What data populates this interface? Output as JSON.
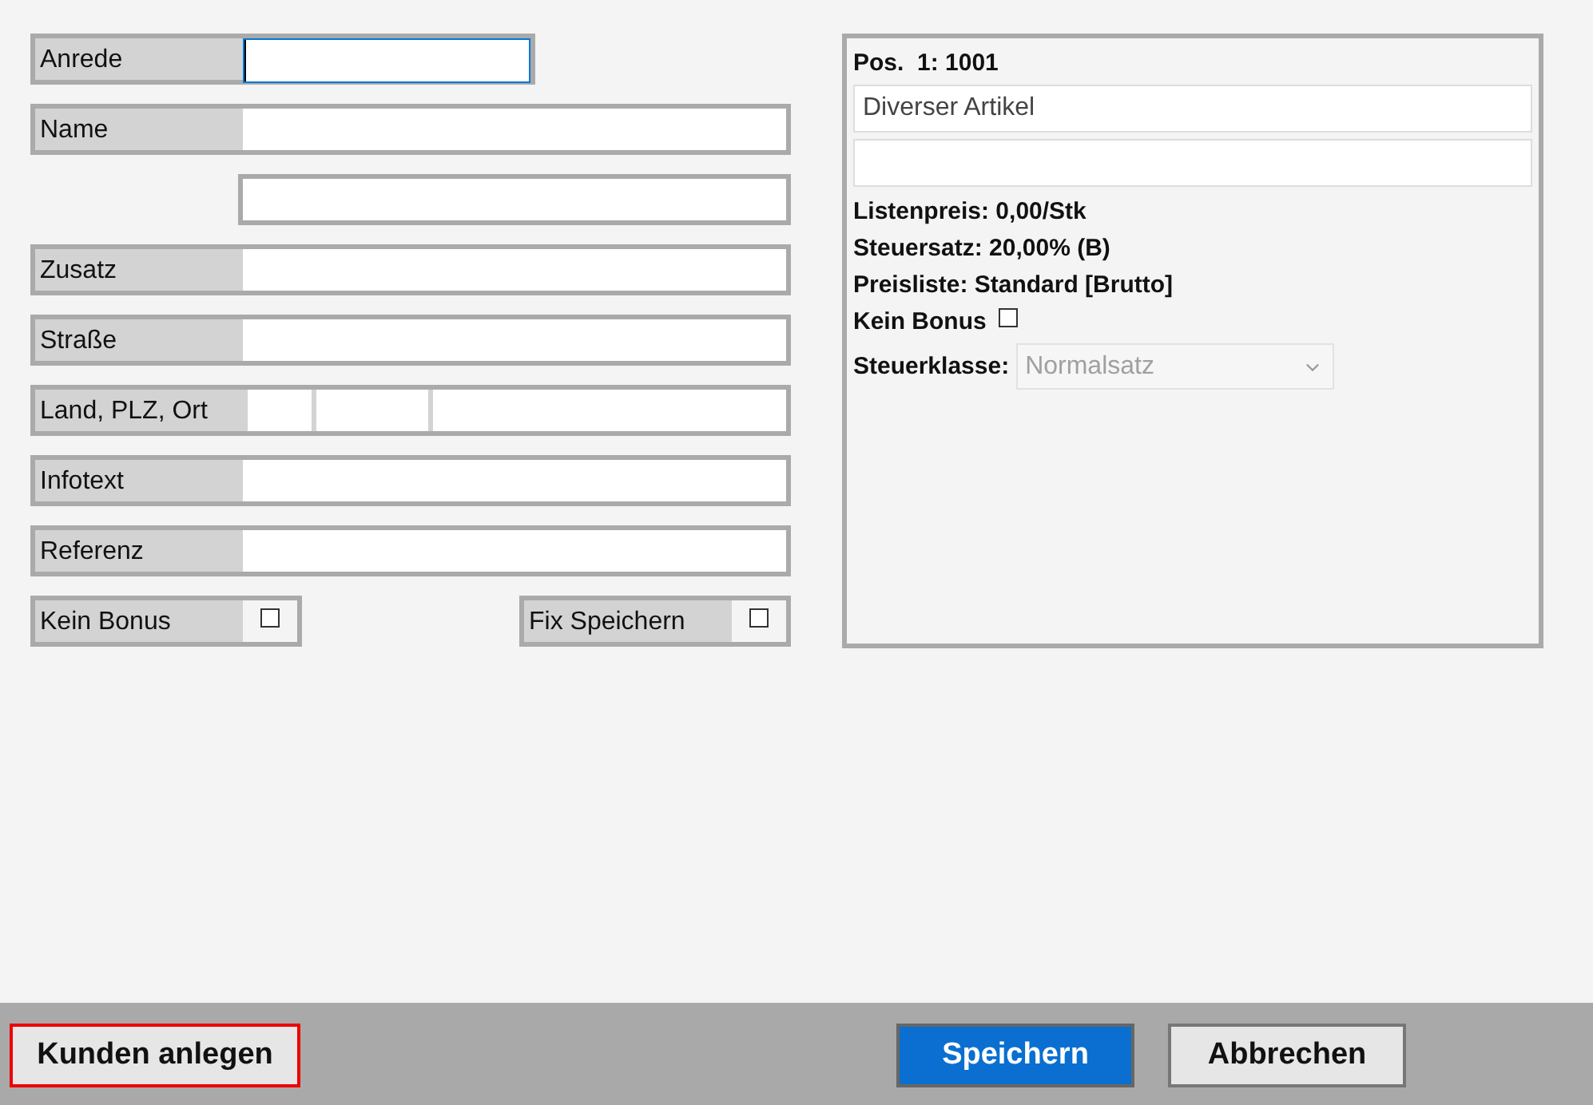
{
  "address_form": {
    "rows": [
      {
        "kind": "short",
        "label": "Anrede",
        "focused": true
      },
      {
        "kind": "text",
        "label": "Name",
        "focused": false
      },
      {
        "kind": "plain",
        "focused": false
      },
      {
        "kind": "text",
        "label": "Zusatz",
        "focused": false
      },
      {
        "kind": "text",
        "label": "Straße",
        "focused": false
      },
      {
        "kind": "triple",
        "label": "Land, PLZ, Ort",
        "focused": false
      },
      {
        "kind": "text",
        "label": "Infotext",
        "focused": false
      },
      {
        "kind": "text",
        "label": "Referenz",
        "focused": false
      }
    ],
    "checkboxes": [
      {
        "label": "Kein Bonus",
        "checked": false
      },
      {
        "label": "Fix Speichern",
        "checked": false
      }
    ]
  },
  "position_panel": {
    "title": "Pos.  1: 1001",
    "description": "Diverser Artikel",
    "info_lines": [
      "Listenpreis: 0,00/Stk",
      "Steuersatz: 20,00% (B)",
      "Preisliste: Standard [Brutto]"
    ],
    "bonus": {
      "label": "Kein Bonus",
      "checked": false
    },
    "tax_class": {
      "label": "Steuerklasse:",
      "value": "Normalsatz",
      "disabled": true
    }
  },
  "footer": {
    "buttons": [
      {
        "kind": "highlighted",
        "label": "Kunden anlegen"
      },
      {
        "kind": "primary",
        "label": "Speichern"
      },
      {
        "kind": "default",
        "label": "Abbrechen"
      }
    ]
  }
}
